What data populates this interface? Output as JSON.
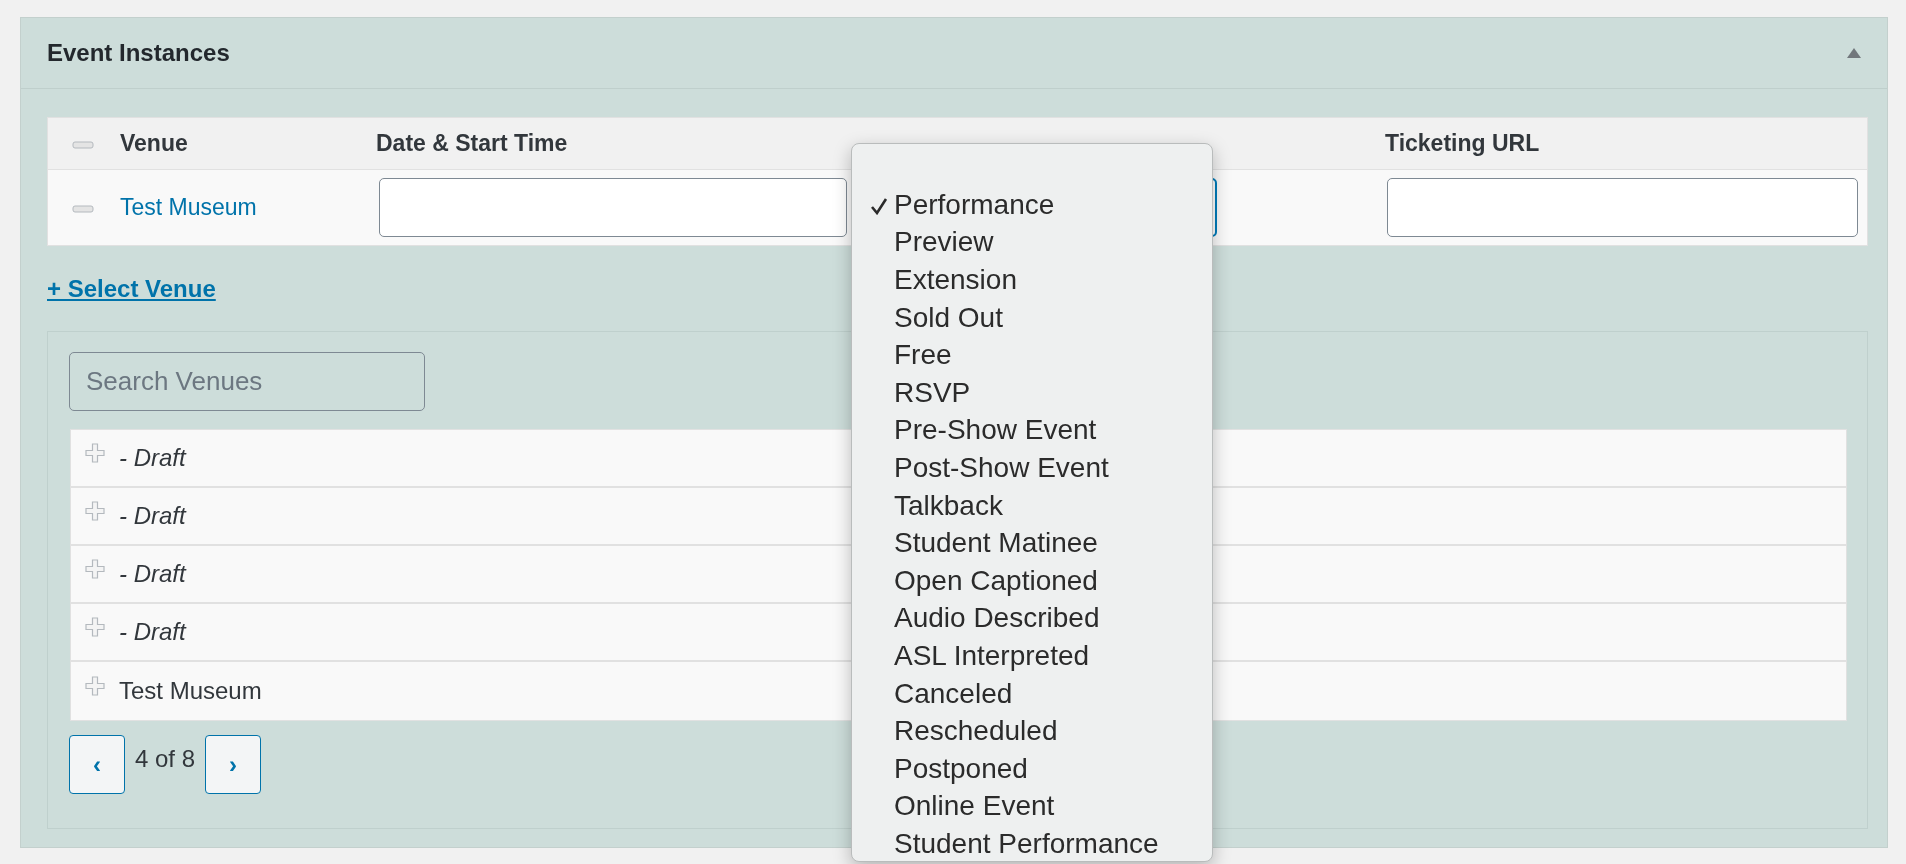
{
  "panel": {
    "title": "Event Instances",
    "collapsed": false
  },
  "table": {
    "columns": [
      "Venue",
      "Date & Start Time",
      "Ticketing URL"
    ],
    "rows": [
      {
        "venue": "Test Museum"
      }
    ]
  },
  "type_menu": {
    "open": true,
    "items": [
      {
        "label": "Performance",
        "selected": true
      },
      {
        "label": "Preview",
        "selected": false
      },
      {
        "label": "Extension",
        "selected": false
      },
      {
        "label": "Sold Out",
        "selected": false
      },
      {
        "label": "Free",
        "selected": false
      },
      {
        "label": "RSVP",
        "selected": false
      },
      {
        "label": "Pre-Show Event",
        "selected": false
      },
      {
        "label": "Post-Show Event",
        "selected": false
      },
      {
        "label": "Talkback",
        "selected": false
      },
      {
        "label": "Student Matinee",
        "selected": false
      },
      {
        "label": "Open Captioned",
        "selected": false
      },
      {
        "label": "Audio Described",
        "selected": false
      },
      {
        "label": "ASL Interpreted",
        "selected": false
      },
      {
        "label": "Canceled",
        "selected": false
      },
      {
        "label": "Rescheduled",
        "selected": false
      },
      {
        "label": "Postponed",
        "selected": false
      },
      {
        "label": "Online Event",
        "selected": false
      },
      {
        "label": "Student Performance",
        "selected": false
      }
    ]
  },
  "select_venue_link": "+ Select Venue",
  "search": {
    "placeholder": "Search Venues"
  },
  "venues": [
    {
      "name": "- Draft",
      "draft": true
    },
    {
      "name": "- Draft",
      "draft": true
    },
    {
      "name": "- Draft",
      "draft": true
    },
    {
      "name": "- Draft",
      "draft": true
    },
    {
      "name": "Test Museum",
      "draft": false
    }
  ],
  "pagination": {
    "prev": "‹",
    "label": "4 of 8",
    "next": "›"
  }
}
